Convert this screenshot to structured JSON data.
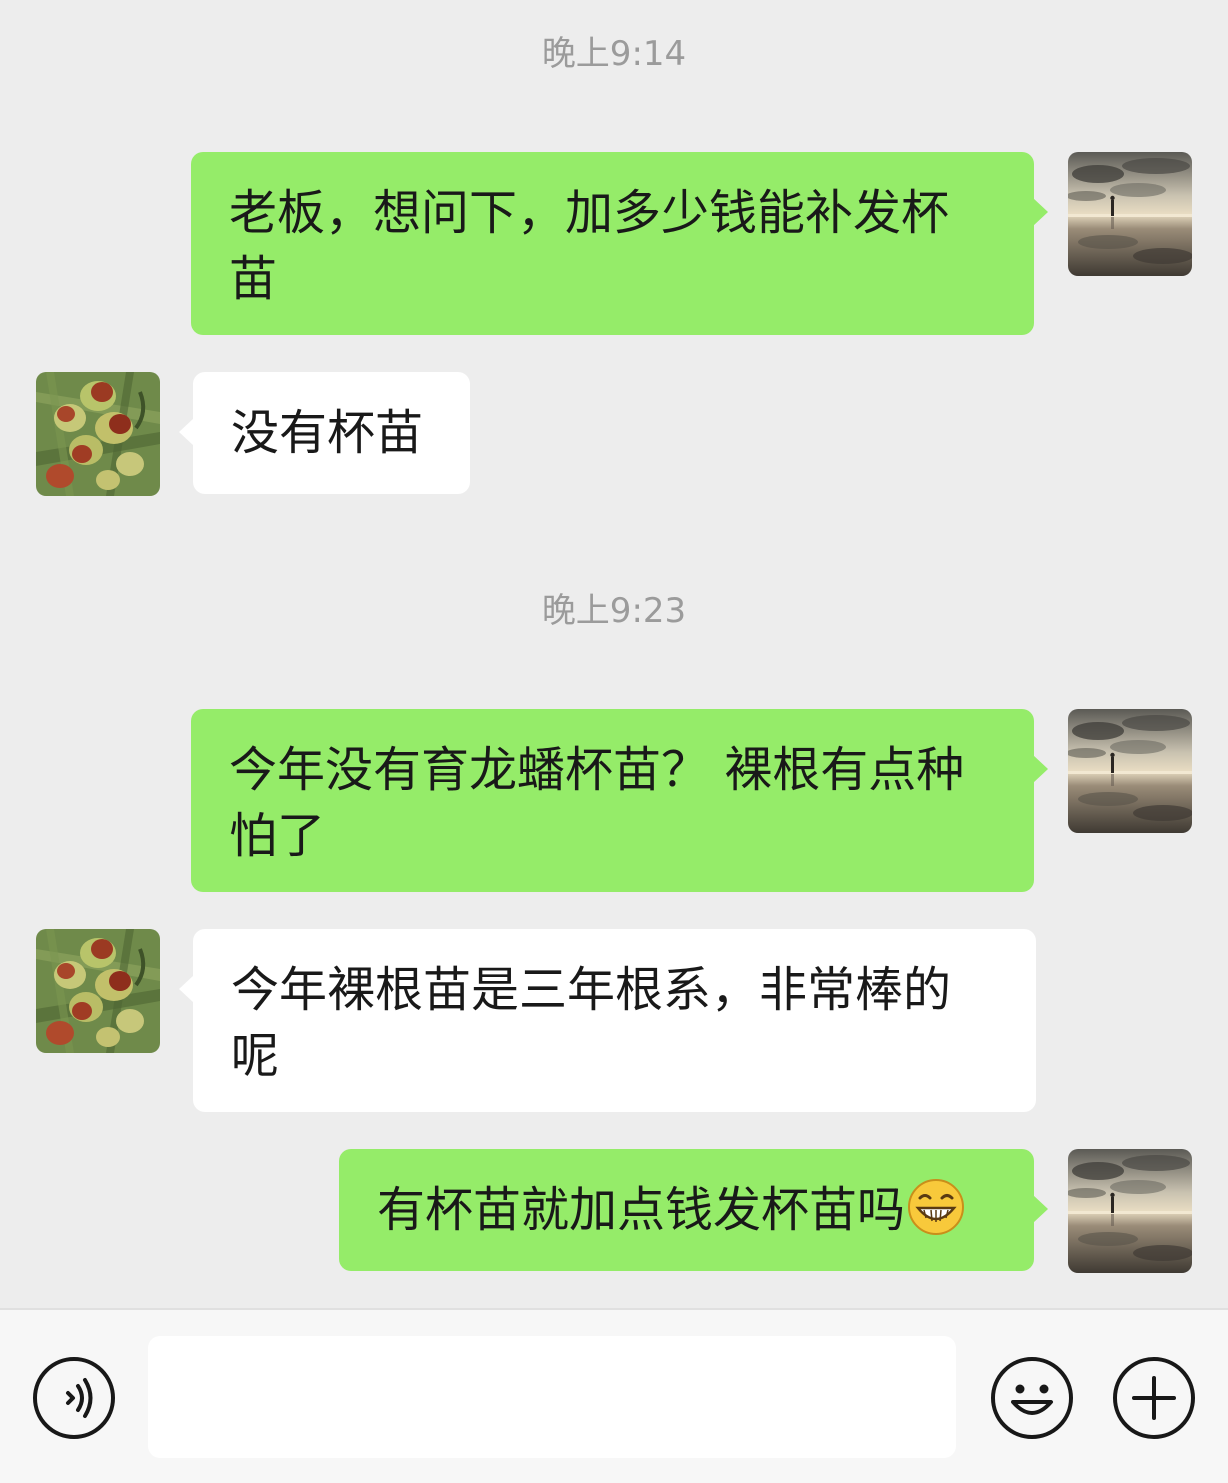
{
  "chat": {
    "timestamps": [
      "晚上9:14",
      "晚上9:23"
    ],
    "messages": [
      {
        "direction": "out",
        "lines": [
          "老板，想问下，加多少钱能补发杯",
          "苗"
        ]
      },
      {
        "direction": "in",
        "lines": [
          "没有杯苗"
        ]
      },
      {
        "direction": "out",
        "lines": [
          "今年没有育龙蟠杯苗？ 裸根有点种",
          "怕了"
        ]
      },
      {
        "direction": "in",
        "lines": [
          "今年裸根苗是三年根系，非常棒的",
          "呢"
        ]
      },
      {
        "direction": "out",
        "lines": [
          "有杯苗就加点钱发杯苗吗"
        ],
        "emoji": "grinning-face-emoji"
      }
    ]
  },
  "avatars": {
    "self": "sunset-beach-photo-avatar",
    "contact": "jujube-fruit-photo-avatar"
  },
  "input_bar": {
    "voice_icon": "voice-input-icon",
    "message_value": "",
    "emoji_icon": "smiley-face-icon",
    "more_icon": "plus-icon"
  },
  "colors": {
    "background": "#ededed",
    "outgoing_bubble": "#95ec69",
    "incoming_bubble": "#ffffff",
    "timestamp_text": "#9b9b9b",
    "input_bar": "#f7f7f7"
  }
}
